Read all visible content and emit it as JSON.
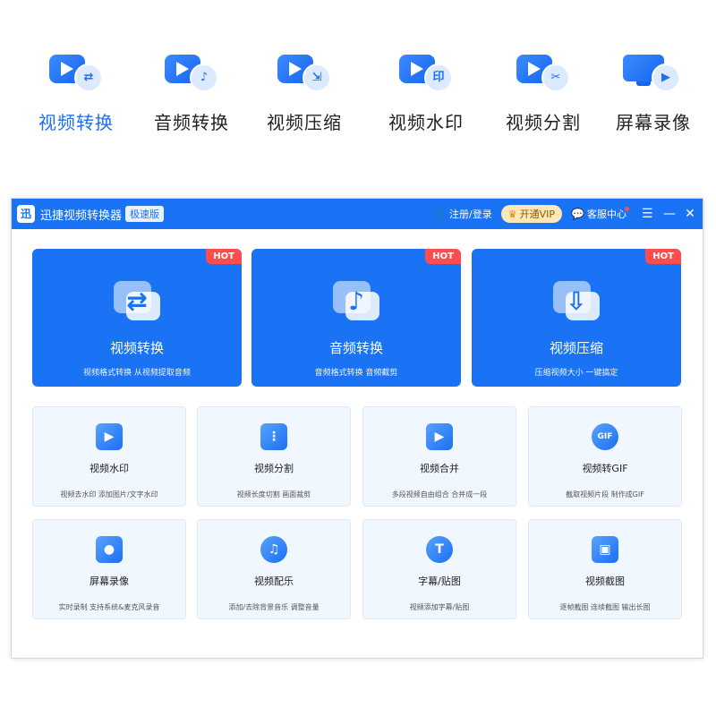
{
  "strip": {
    "items": [
      {
        "label": "视频转换",
        "badge": "⇄",
        "icon": "video-convert-icon",
        "active": true
      },
      {
        "label": "音频转换",
        "badge": "♪",
        "icon": "audio-convert-icon",
        "active": false
      },
      {
        "label": "视频压缩",
        "badge": "⇲",
        "icon": "video-compress-icon",
        "active": false
      },
      {
        "label": "视频水印",
        "badge": "印",
        "icon": "video-watermark-icon",
        "active": false
      },
      {
        "label": "视频分割",
        "badge": "✂",
        "icon": "video-split-icon",
        "active": false
      },
      {
        "label": "屏幕录像",
        "badge": "▶",
        "icon": "screen-record-icon",
        "active": false
      }
    ]
  },
  "window": {
    "logo": "迅",
    "title": "迅捷视频转换器",
    "edition": "极速版",
    "login": "注册/登录",
    "vip": "开通VIP",
    "service": "客服中心",
    "menu_icon": "☰",
    "minimize_icon": "—",
    "close_icon": "✕"
  },
  "big_cards": [
    {
      "title": "视频转换",
      "sub": "视频格式转换 从视频提取音频",
      "hot": "HOT",
      "glyph": "⇄"
    },
    {
      "title": "音频转换",
      "sub": "音频格式转换 音频截剪",
      "hot": "HOT",
      "glyph": "♪"
    },
    {
      "title": "视频压缩",
      "sub": "压缩视频大小 一键搞定",
      "hot": "HOT",
      "glyph": "⇩"
    }
  ],
  "small_cards": [
    {
      "title": "视频水印",
      "sub": "视频去水印 添加图片/文字水印",
      "glyph": "▶"
    },
    {
      "title": "视频分割",
      "sub": "视频长度切割 画面裁剪",
      "glyph": "⋮"
    },
    {
      "title": "视频合并",
      "sub": "多段视频自由组合 合并成一段",
      "glyph": "▶"
    },
    {
      "title": "视频转GIF",
      "sub": "截取视频片段 制作成GIF",
      "glyph": "GIF"
    },
    {
      "title": "屏幕录像",
      "sub": "实时录制 支持系统&麦克风录音",
      "glyph": "●"
    },
    {
      "title": "视频配乐",
      "sub": "添加/去除背景音乐 调整音量",
      "glyph": "♫"
    },
    {
      "title": "字幕/贴图",
      "sub": "视频添加字幕/贴图",
      "glyph": "T"
    },
    {
      "title": "视频截图",
      "sub": "逐帧截图 连续截图 输出长图",
      "glyph": "▣"
    }
  ]
}
